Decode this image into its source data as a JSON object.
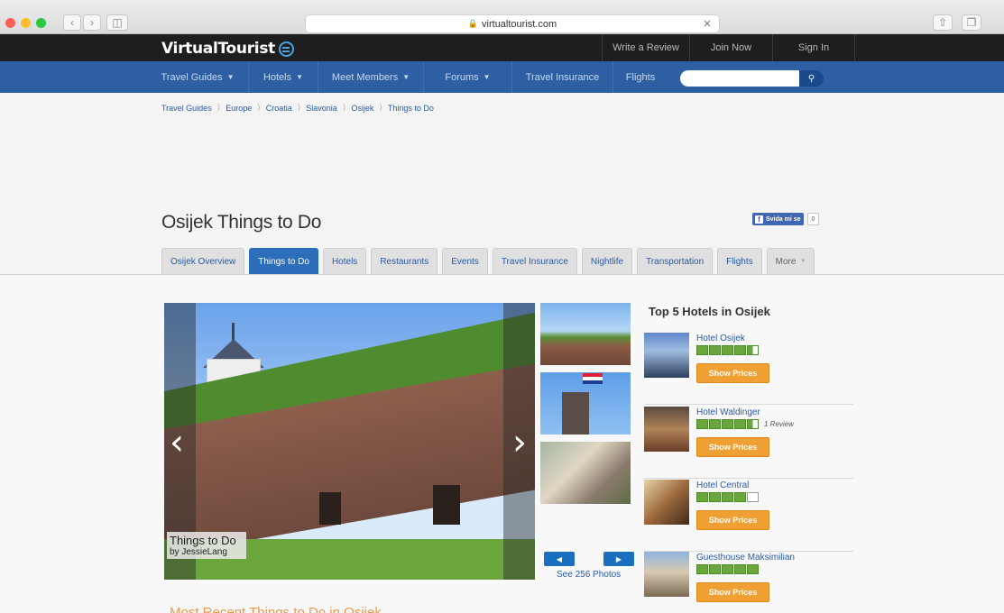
{
  "browser": {
    "url": "virtualtourist.com",
    "lights": [
      "#fe5f57",
      "#febc2e",
      "#28c840"
    ]
  },
  "site": {
    "logo": "VirtualTourist",
    "top_links": [
      "Write a Review",
      "Join Now",
      "Sign In"
    ]
  },
  "nav": {
    "items": [
      {
        "label": "Travel Guides",
        "dropdown": true
      },
      {
        "label": "Hotels",
        "dropdown": true
      },
      {
        "label": "Meet Members",
        "dropdown": true
      },
      {
        "label": "Forums",
        "dropdown": true
      },
      {
        "label": "Travel Insurance",
        "dropdown": false
      },
      {
        "label": "Flights",
        "dropdown": false
      }
    ],
    "search_placeholder": ""
  },
  "breadcrumbs": [
    "Travel Guides",
    "Europe",
    "Croatia",
    "Slavonia",
    "Osijek",
    "Things to Do"
  ],
  "page": {
    "title": "Osijek Things to Do",
    "fb_like": "Svida mi se",
    "fb_count": "0"
  },
  "tabs": [
    {
      "label": "Osijek Overview",
      "active": false
    },
    {
      "label": "Things to Do",
      "active": true
    },
    {
      "label": "Hotels",
      "active": false
    },
    {
      "label": "Restaurants",
      "active": false
    },
    {
      "label": "Events",
      "active": false
    },
    {
      "label": "Travel Insurance",
      "active": false
    },
    {
      "label": "Nightlife",
      "active": false
    },
    {
      "label": "Transportation",
      "active": false
    },
    {
      "label": "Flights",
      "active": false
    },
    {
      "label": "More",
      "active": false
    }
  ],
  "gallery": {
    "caption_title": "Things to Do",
    "caption_by": "by JessieLang",
    "see_photos": "See 256 Photos"
  },
  "hotels": {
    "title": "Top 5 Hotels in Osijek",
    "button_label": "Show Prices",
    "items": [
      {
        "name": "Hotel Osijek",
        "rating": 4.5,
        "reviews": ""
      },
      {
        "name": "Hotel Waldinger",
        "rating": 4.5,
        "reviews": "1 Review"
      },
      {
        "name": "Hotel Central",
        "rating": 4,
        "reviews": ""
      },
      {
        "name": "Guesthouse Maksimilian",
        "rating": 5,
        "reviews": ""
      }
    ]
  },
  "recent_heading": "Most Recent Things to Do in Osijek"
}
